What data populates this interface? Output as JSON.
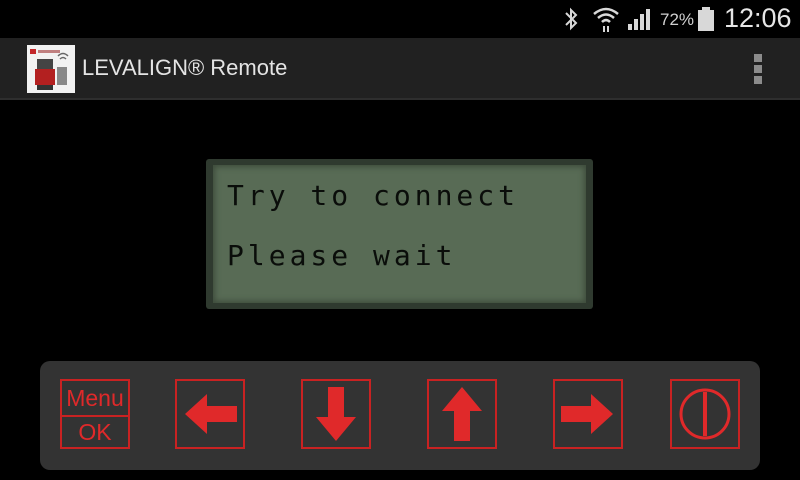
{
  "status_bar": {
    "battery_percent": "72%",
    "time": "12:06",
    "icons": [
      "bluetooth-icon",
      "wifi-icon",
      "signal-icon",
      "battery-icon"
    ]
  },
  "app_bar": {
    "title": "LEVALIGN® Remote",
    "icon": "app-logo-icon",
    "overflow_icon": "overflow-menu-icon"
  },
  "display": {
    "line1": "Try to connect",
    "line2": "Please wait"
  },
  "controls": {
    "menu_label": "Menu",
    "ok_label": "OK",
    "buttons": [
      "left-arrow-icon",
      "down-arrow-icon",
      "up-arrow-icon",
      "right-arrow-icon",
      "power-icon"
    ]
  },
  "colors": {
    "accent_red": "#e0292a",
    "lcd_green": "#586b55",
    "panel": "#333333"
  }
}
